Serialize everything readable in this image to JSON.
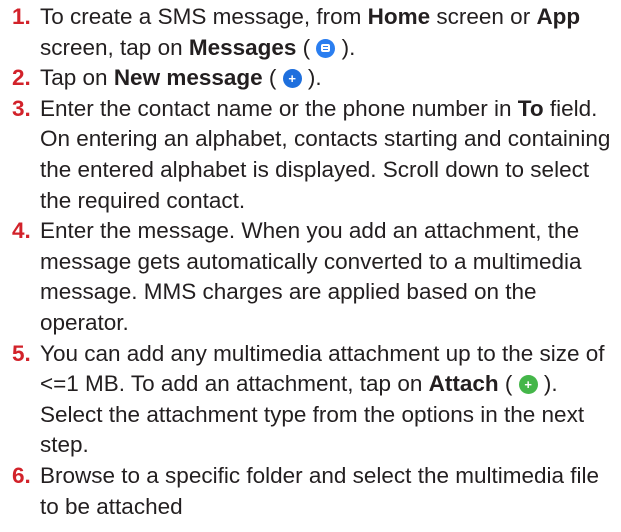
{
  "steps": [
    {
      "number": "1.",
      "t1": "To create a SMS message, from ",
      "b1": "Home",
      "t2": " screen or ",
      "b2": "App",
      "t3": " screen, tap on ",
      "b3": "Messages",
      "t4": " ( ",
      "t5": " ).",
      "icon": "messages-icon"
    },
    {
      "number": "2.",
      "t1": "Tap on ",
      "b1": "New message",
      "t2": " ( ",
      "t3": " ).",
      "icon": "new-message-icon"
    },
    {
      "number": "3.",
      "t1": "Enter the contact name or the phone number in ",
      "b1": "To",
      "t2": " field. On entering an alphabet, contacts starting and containing the entered alphabet is displayed. Scroll down to select the required contact."
    },
    {
      "number": "4.",
      "t1": "Enter the message. When you add an attachment, the message gets automatically converted to a multimedia message. MMS charges are applied based on the operator."
    },
    {
      "number": "5.",
      "t1": "You can add any multimedia attachment up to the size of <=1 MB. To add an attachment, tap on ",
      "b1": "Attach",
      "t2": " ( ",
      "t3": " ). Select the attachment type from the options in the next step.",
      "icon": "attach-icon"
    },
    {
      "number": "6.",
      "t1": "Browse to a specific folder and select the multimedia file to be attached"
    }
  ],
  "colors": {
    "number": "#d2222a",
    "text": "#231f20",
    "messages_icon": "#2a7ef0",
    "new_message_icon": "#1e6fdd",
    "attach_icon": "#44b649"
  }
}
